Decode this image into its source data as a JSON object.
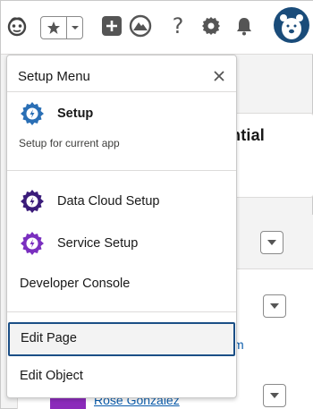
{
  "header": {
    "icons": [
      "einstein-icon",
      "star-icon",
      "chevron-down-icon",
      "add-icon",
      "trailhead-icon",
      "help-icon",
      "gear-icon",
      "bell-icon"
    ],
    "avatar_icon": "bear-avatar-icon"
  },
  "background": {
    "card_title_partial": "ntial",
    "link_partial": "m",
    "contact_name_partial": "Rose Gonzalez"
  },
  "setup_menu": {
    "title": "Setup Menu",
    "close_icon": "close-icon",
    "setup": {
      "label": "Setup",
      "subtitle": "Setup for current app"
    },
    "items": [
      {
        "label": "Data Cloud Setup",
        "icon": "gear-icon",
        "color": "#3b1c7a"
      },
      {
        "label": "Service Setup",
        "icon": "gear-icon",
        "color": "#7a2fbf"
      }
    ],
    "developer_console": "Developer Console",
    "edit_page": "Edit Page",
    "edit_object": "Edit Object"
  },
  "colors": {
    "setup_gear": "#2a6fb5",
    "data_cloud_gear": "#3b1c7a",
    "service_gear": "#7a2fbf",
    "focus_border": "#1b4f86",
    "link": "#0b5cab"
  }
}
